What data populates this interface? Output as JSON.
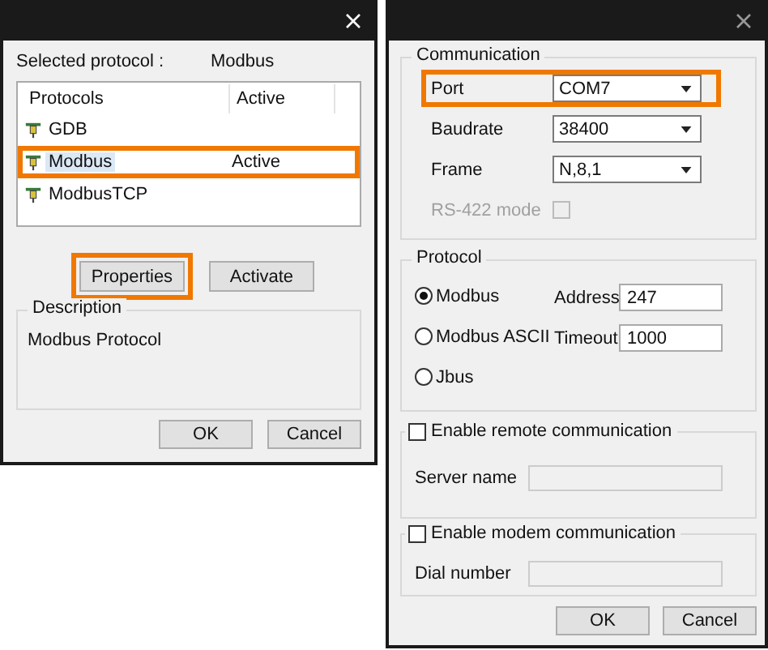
{
  "left_window": {
    "selected_protocol": {
      "label": "Selected protocol :",
      "value": "Modbus"
    },
    "protocol_list": {
      "columns": [
        "Protocols",
        "Active"
      ],
      "rows": [
        {
          "name": "GDB",
          "selected": false,
          "highlighted": false
        },
        {
          "name": "Modbus",
          "active": "Active",
          "selected": true,
          "highlighted": true
        },
        {
          "name": "ModbusTCP",
          "selected": false,
          "highlighted": false
        }
      ]
    },
    "buttons": [
      {
        "label": "Properties",
        "highlighted": true
      },
      {
        "label": "Activate",
        "highlighted": false
      }
    ],
    "description": {
      "title": "Description",
      "text": "Modbus Protocol"
    },
    "footer_buttons": [
      "OK",
      "Cancel"
    ]
  },
  "right_window": {
    "communication": {
      "title": "Communication",
      "fields": [
        {
          "kind": "dropdown",
          "label": "Port",
          "value": "COM7",
          "highlighted": true
        },
        {
          "kind": "dropdown",
          "label": "Baudrate",
          "value": "38400",
          "highlighted": false
        },
        {
          "kind": "dropdown",
          "label": "Frame",
          "value": "N,8,1",
          "highlighted": false
        },
        {
          "kind": "checkbox",
          "label": "RS-422 mode",
          "checked": false,
          "disabled": true
        }
      ]
    },
    "protocol": {
      "title": "Protocol",
      "options": [
        {
          "label": "Modbus",
          "selected": true
        },
        {
          "label": "Modbus ASCII",
          "selected": false
        },
        {
          "label": "Jbus",
          "selected": false
        }
      ],
      "fields": [
        {
          "label": "Address",
          "value": "247"
        },
        {
          "label": "Timeout",
          "value": "1000"
        }
      ]
    },
    "remote": {
      "label": "Enable remote communication",
      "checked": false,
      "field_label": "Server name",
      "disabled": true
    },
    "modem": {
      "label": "Enable modem communication",
      "checked": false,
      "field_label": "Dial number",
      "disabled": true
    },
    "footer_buttons": [
      "OK",
      "Cancel"
    ]
  }
}
